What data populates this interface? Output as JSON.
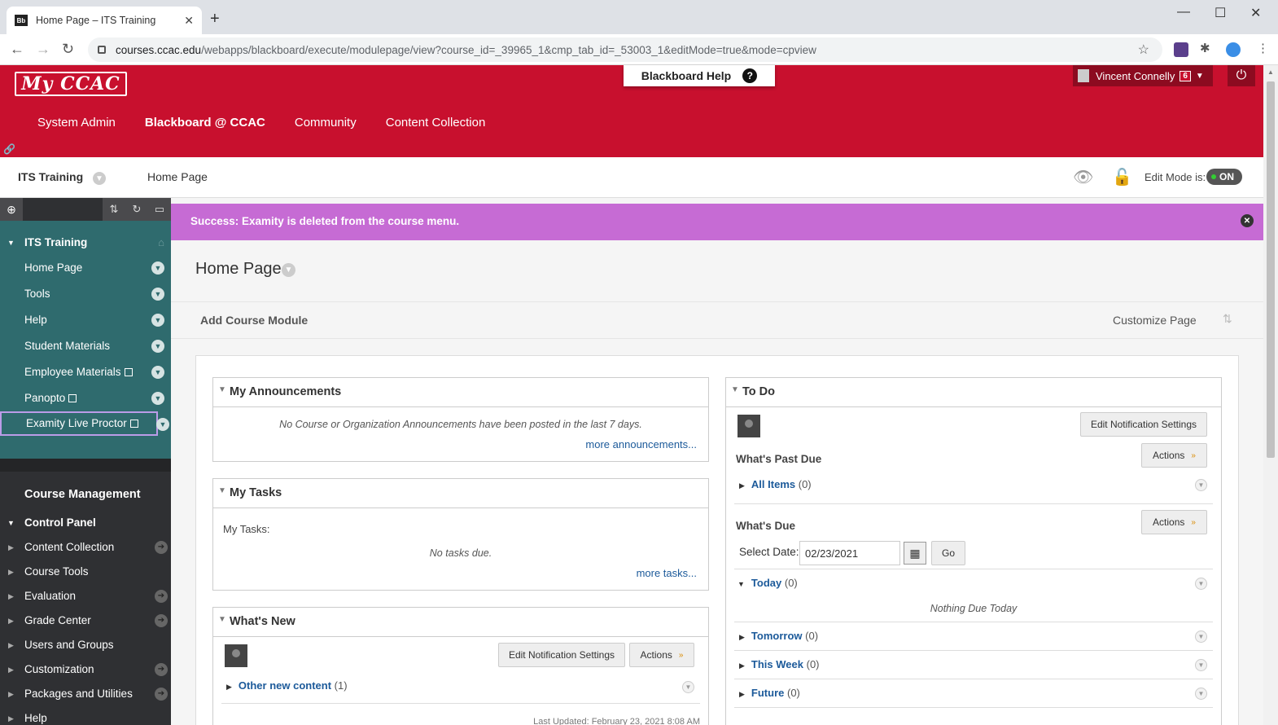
{
  "browser": {
    "tab_title": "Home Page – ITS Training",
    "url_host": "courses.ccac.edu",
    "url_path": "/webapps/blackboard/execute/modulepage/view?course_id=_39965_1&cmp_tab_id=_53003_1&editMode=true&mode=cpview"
  },
  "header": {
    "logo_text": "My CCAC",
    "help_label": "Blackboard Help",
    "user_name": "Vincent Connelly",
    "notification_count": "6",
    "nav": [
      "System Admin",
      "Blackboard @ CCAC",
      "Community",
      "Content Collection"
    ],
    "accent": "#c8102e"
  },
  "crumbs": {
    "course": "ITS Training",
    "page": "Home Page",
    "edit_mode_label": "Edit Mode is:",
    "edit_mode_value": "ON"
  },
  "sidebar": {
    "course_title": "ITS Training",
    "items": [
      "Home Page",
      "Tools",
      "Help",
      "Student Materials",
      "Employee Materials",
      "Panopto",
      "Examity Live Proctor"
    ],
    "course_management": "Course Management",
    "control_panel": "Control Panel",
    "cp_items": [
      "Content Collection",
      "Course Tools",
      "Evaluation",
      "Grade Center",
      "Users and Groups",
      "Customization",
      "Packages and Utilities",
      "Help"
    ]
  },
  "main": {
    "success_message": "Success: Examity is deleted from the course menu.",
    "page_title": "Home Page",
    "add_module": "Add Course Module",
    "customize": "Customize Page"
  },
  "announcements": {
    "title": "My Announcements",
    "empty": "No Course or Organization Announcements have been posted in the last 7 days.",
    "more": "more announcements..."
  },
  "tasks": {
    "title": "My Tasks",
    "label": "My Tasks:",
    "empty": "No tasks due.",
    "more": "more tasks..."
  },
  "whatsnew": {
    "title": "What's New",
    "edit_btn": "Edit Notification Settings",
    "actions_btn": "Actions",
    "row_label": "Other new content",
    "row_count": "(1)",
    "last_updated": "Last Updated: February 23, 2021 8:08 AM"
  },
  "todo": {
    "title": "To Do",
    "edit_btn": "Edit Notification Settings",
    "past_due_title": "What's Past Due",
    "actions_btn": "Actions",
    "all_items": "All Items",
    "all_items_count": "(0)",
    "due_title": "What's Due",
    "select_date_label": "Select Date:",
    "date_value": "02/23/2021",
    "go_btn": "Go",
    "today": "Today",
    "today_count": "(0)",
    "nothing_due": "Nothing Due Today",
    "tomorrow": "Tomorrow",
    "tomorrow_count": "(0)",
    "this_week": "This Week",
    "this_week_count": "(0)",
    "future": "Future",
    "future_count": "(0)"
  }
}
